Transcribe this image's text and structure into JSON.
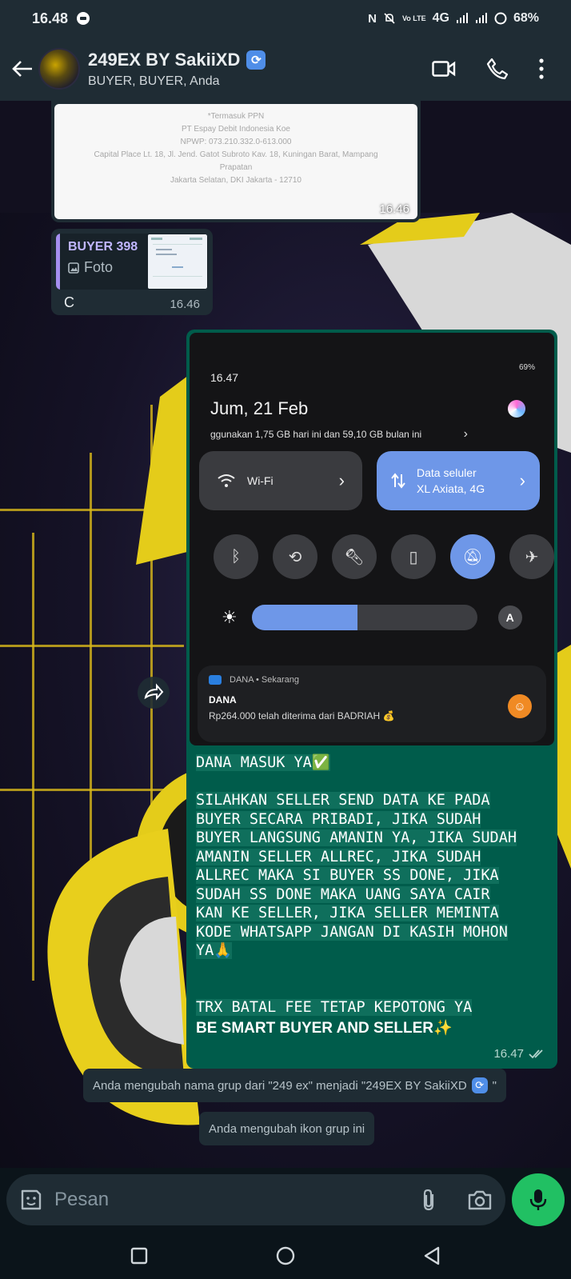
{
  "status_bar": {
    "time": "16.48",
    "network": "4G",
    "battery": "68%"
  },
  "header": {
    "group_name": "249EX BY SakiiXD",
    "members": "BUYER, BUYER, Anda"
  },
  "messages": {
    "receipt": {
      "lines": [
        "*Termasuk PPN",
        "PT Espay Debit Indonesia Koe",
        "NPWP: 073.210.332.0-613.000",
        "Capital Place Lt. 18, Jl. Jend. Gatot Subroto Kav. 18, Kuningan Barat, Mampang",
        "Prapatan",
        "Jakarta Selatan, DKI Jakarta - 12710"
      ],
      "time": "16.46"
    },
    "reply": {
      "quoted_name": "BUYER 398",
      "quoted_type": "Foto",
      "text": "C",
      "time": "16.46"
    },
    "outgoing": {
      "screenshot": {
        "time": "16.47",
        "status_right": "69%",
        "date": "Jum, 21 Feb",
        "usage": "ggunakan 1,75 GB hari ini dan 59,10 GB bulan ini",
        "wifi_label": "Wi-Fi",
        "data_label": "Data seluler",
        "data_sub": "XL Axiata, 4G",
        "brightness_level": 0.47,
        "auto_label": "A",
        "notif_app": "DANA • Sekarang",
        "notif_title": "DANA",
        "notif_body": "Rp264.000 telah diterima dari BADRIAH 💰"
      },
      "line1": "DANA MASUK YA✅",
      "body": "SILAHKAN SELLER SEND DATA KE PADA\nBUYER SECARA PRIBADI, JIKA SUDAH\nBUYER LANGSUNG AMANIN YA, JIKA SUDAH\nAMANIN SELLER ALLREC, JIKA SUDAH\nALLREC MAKA SI BUYER SS DONE, JIKA\nSUDAH SS DONE MAKA UANG SAYA CAIR\nKAN KE SELLER, JIKA SELLER MEMINTA\nKODE WHATSAPP JANGAN DI KASIH MOHON\nYA🙏",
      "line_trx": "TRX BATAL FEE TETAP KEPOTONG YA",
      "line_last": "BE SMART BUYER AND SELLER✨",
      "time": "16.47"
    },
    "system_rename": "Anda mengubah nama grup dari \"249 ex\" menjadi \"249EX BY SakiiXD",
    "system_rename_end": "\"",
    "system_icon": "Anda mengubah ikon grup ini"
  },
  "input": {
    "placeholder": "Pesan"
  },
  "colors": {
    "accent_green": "#21c063",
    "outgoing_bubble": "#005c4b",
    "header_bg": "#1f2c34"
  },
  "icons": [
    "back-arrow-icon",
    "video-call-icon",
    "phone-icon",
    "more-vert-icon",
    "sticker-icon",
    "attach-icon",
    "camera-icon",
    "mic-icon",
    "forward-icon"
  ]
}
